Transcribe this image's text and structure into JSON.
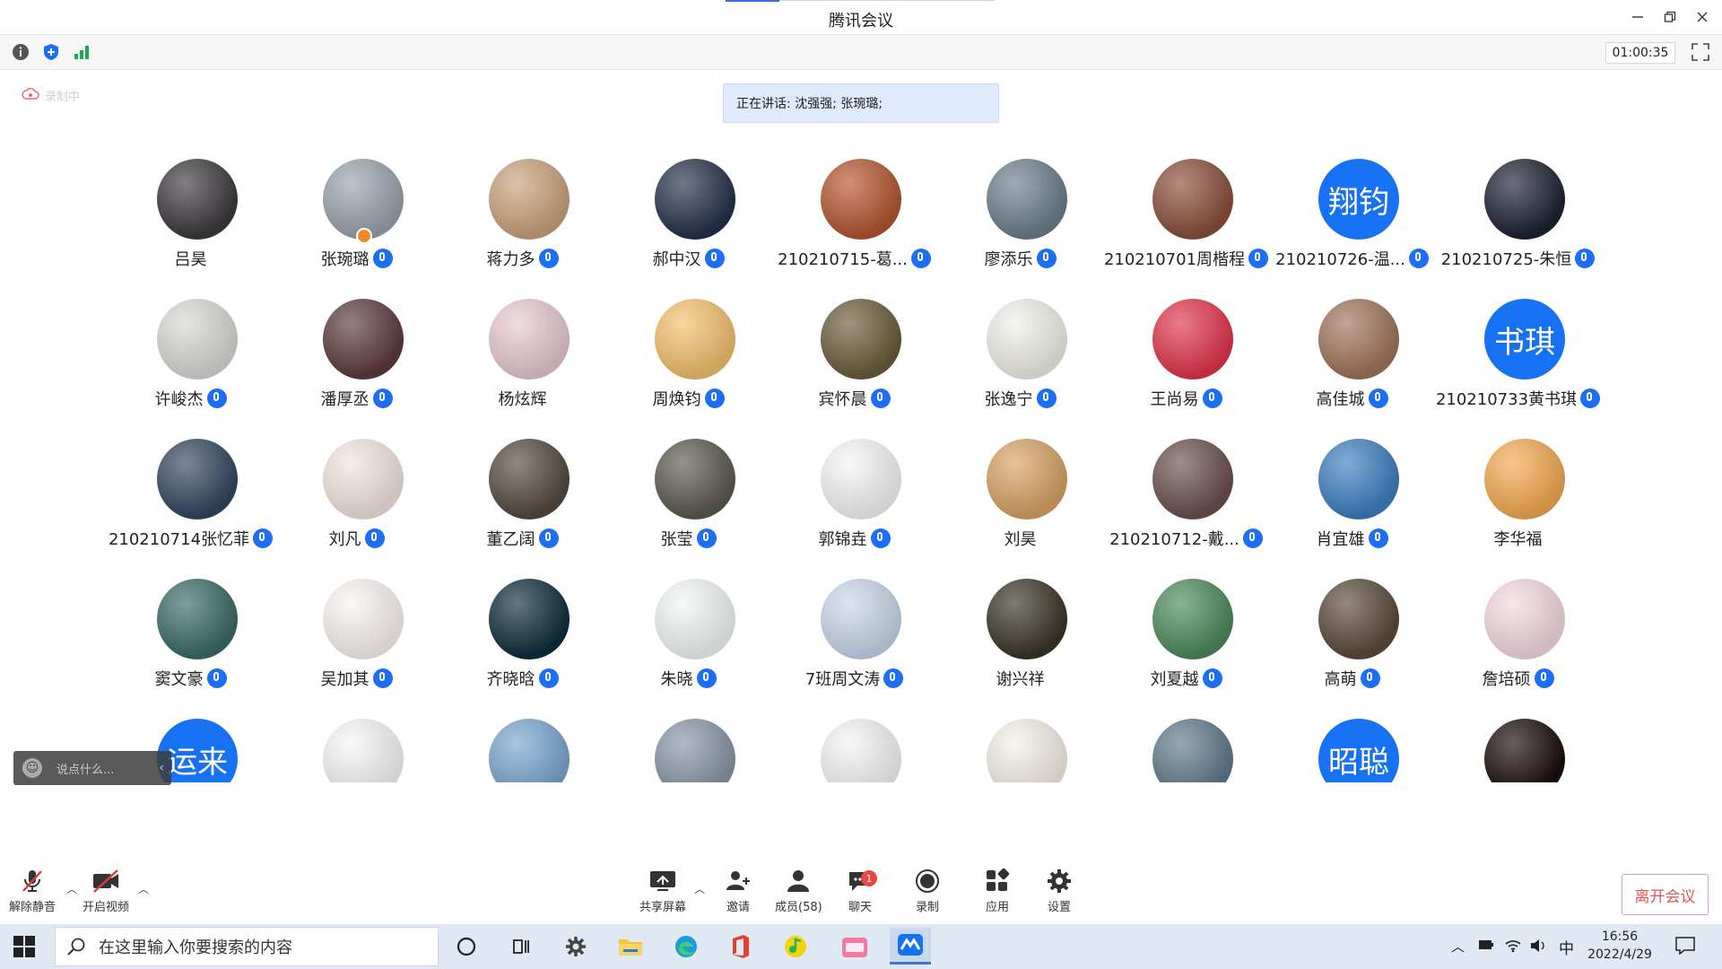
{
  "window": {
    "title": "腾讯会议",
    "controls": [
      "minimize-icon",
      "restore-icon",
      "close-icon"
    ]
  },
  "toolbar": {
    "icons": [
      "info-icon",
      "shield-icon",
      "signal-icon"
    ],
    "timer": "01:00:35",
    "fullscreen_icon": "fullscreen-icon"
  },
  "recording": {
    "label": "录制中",
    "icon": "cloud-icon"
  },
  "speaking": {
    "text": "正在讲话: 沈强强; 张琬璐;"
  },
  "participants": [
    {
      "name": "吕昊",
      "mic": false,
      "avatar": "#3d3a3e"
    },
    {
      "name": "张琬璐",
      "mic": true,
      "avatar": "#9aa3ad",
      "host": true
    },
    {
      "name": "蒋力多",
      "mic": true,
      "avatar": "#c9a27c"
    },
    {
      "name": "郝中汉",
      "mic": true,
      "avatar": "#25314b"
    },
    {
      "name": "210210715-葛...",
      "mic": true,
      "avatar": "#b4562f"
    },
    {
      "name": "廖添乐",
      "mic": true,
      "avatar": "#6b7f8c"
    },
    {
      "name": "210210701周楷程",
      "mic": true,
      "avatar": "#8a4f3a"
    },
    {
      "name": "210210726-温...",
      "mic": true,
      "avatar_text": "翔钧"
    },
    {
      "name": "210210725-朱恒",
      "mic": true,
      "avatar": "#1d2233"
    },
    {
      "name": "许峻杰",
      "mic": true,
      "avatar": "#d7d9d3"
    },
    {
      "name": "潘厚丞",
      "mic": true,
      "avatar": "#5d3a3e"
    },
    {
      "name": "杨炫辉",
      "mic": false,
      "avatar": "#e7c9d0"
    },
    {
      "name": "周焕钧",
      "mic": true,
      "avatar": "#f3c06d"
    },
    {
      "name": "宾怀晨",
      "mic": true,
      "avatar": "#6b5d3a"
    },
    {
      "name": "张逸宁",
      "mic": true,
      "avatar": "#f0efe8"
    },
    {
      "name": "王尚易",
      "mic": true,
      "avatar": "#e0354b"
    },
    {
      "name": "高佳城",
      "mic": true,
      "avatar": "#a0745b"
    },
    {
      "name": "210210733黄书琪",
      "mic": true,
      "avatar_text": "书琪"
    },
    {
      "name": "210210714张忆菲",
      "mic": true,
      "avatar": "#33475f"
    },
    {
      "name": "刘凡",
      "mic": true,
      "avatar": "#f3e4e0"
    },
    {
      "name": "董乙阔",
      "mic": true,
      "avatar": "#56493f"
    },
    {
      "name": "张莹",
      "mic": true,
      "avatar": "#5a5a50"
    },
    {
      "name": "郭锦垚",
      "mic": true,
      "avatar": "#f5f5f5"
    },
    {
      "name": "刘昊",
      "mic": false,
      "avatar": "#d8a264"
    },
    {
      "name": "210210712-戴...",
      "mic": true,
      "avatar": "#6b4f4f"
    },
    {
      "name": "肖宜雄",
      "mic": true,
      "avatar": "#3c7fc0"
    },
    {
      "name": "李华福",
      "mic": false,
      "avatar": "#f4a950"
    },
    {
      "name": "窦文豪",
      "mic": true,
      "avatar": "#3a6b68"
    },
    {
      "name": "吴加其",
      "mic": true,
      "avatar": "#faf4f0"
    },
    {
      "name": "齐晓晗",
      "mic": true,
      "avatar": "#0e2e3d"
    },
    {
      "name": "朱晓",
      "mic": true,
      "avatar": "#f1f6f3"
    },
    {
      "name": "7班周文涛",
      "mic": true,
      "avatar": "#c9d7ea"
    },
    {
      "name": "谢兴祥",
      "mic": false,
      "avatar": "#3a3528"
    },
    {
      "name": "刘夏越",
      "mic": true,
      "avatar": "#4c8a5a"
    },
    {
      "name": "高萌",
      "mic": true,
      "avatar": "#5a4a3a"
    },
    {
      "name": "詹培硕",
      "mic": true,
      "avatar": "#f5d9e0"
    },
    {
      "name": "",
      "mic": false,
      "avatar_text": "运来"
    },
    {
      "name": "",
      "mic": false,
      "avatar": "#f6f6f6"
    },
    {
      "name": "",
      "mic": false,
      "avatar": "#7aa6cf"
    },
    {
      "name": "",
      "mic": false,
      "avatar": "#8896a8"
    },
    {
      "name": "",
      "mic": false,
      "avatar": "#f4f4f4"
    },
    {
      "name": "",
      "mic": false,
      "avatar": "#f4efe6"
    },
    {
      "name": "",
      "mic": false,
      "avatar": "#5f7a8c"
    },
    {
      "name": "",
      "mic": false,
      "avatar_text": "昭聪"
    },
    {
      "name": "",
      "mic": false,
      "avatar": "#1a0a0a"
    }
  ],
  "chat_input": {
    "placeholder": "说点什么..."
  },
  "bottombar": {
    "unmute": "解除静音",
    "start_video": "开启视频",
    "share": "共享屏幕",
    "invite": "邀请",
    "members": "成员(58)",
    "chat": "聊天",
    "chat_badge": "1",
    "record": "录制",
    "apps": "应用",
    "settings": "设置",
    "leave": "离开会议"
  },
  "taskbar": {
    "search_placeholder": "在这里输入你要搜索的内容",
    "ime": "中",
    "time": "16:56",
    "date": "2022/4/29"
  }
}
